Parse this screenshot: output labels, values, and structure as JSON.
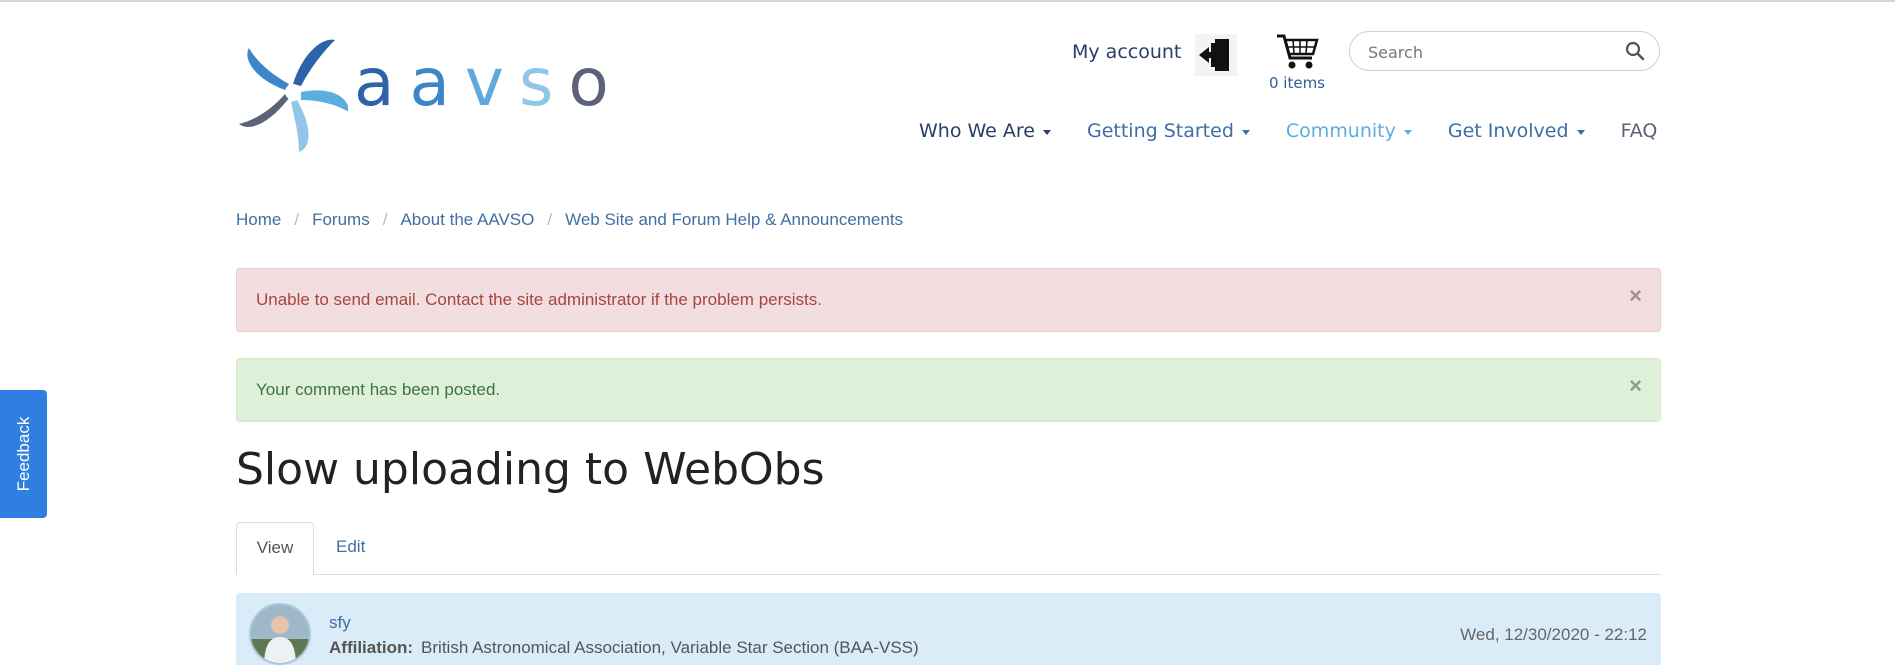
{
  "logo": {
    "letters": [
      "a",
      "a",
      "v",
      "s",
      "o"
    ]
  },
  "header": {
    "account_label": "My account",
    "cart_count": "0 items",
    "search_placeholder": "Search"
  },
  "nav": {
    "items": [
      {
        "label": "Who We Are",
        "has_dropdown": true
      },
      {
        "label": "Getting Started",
        "has_dropdown": true
      },
      {
        "label": "Community",
        "has_dropdown": true
      },
      {
        "label": "Get Involved",
        "has_dropdown": true
      },
      {
        "label": "FAQ",
        "has_dropdown": false
      }
    ]
  },
  "breadcrumb": {
    "items": [
      "Home",
      "Forums",
      "About the AAVSO",
      "Web Site and Forum Help & Announcements"
    ],
    "separator": "/"
  },
  "alerts": {
    "error": {
      "text": "Unable to send email. Contact the site administrator if the problem persists.",
      "close": "×"
    },
    "success": {
      "text": "Your comment has been posted.",
      "close": "×"
    }
  },
  "feedback": {
    "label": "Feedback"
  },
  "page": {
    "title": "Slow uploading to WebObs",
    "tabs": [
      "View",
      "Edit"
    ],
    "active_tab": "View"
  },
  "comment": {
    "author": "sfy",
    "affiliation_label": "Affiliation:",
    "affiliation": "British Astronomical Association, Variable Star Section (BAA-VSS)",
    "date": "Wed, 12/30/2020 - 22:12"
  },
  "colors": {
    "brand_dark": "#2a3d67",
    "link": "#3f6fa3",
    "community_active": "#5aaee0",
    "alert_error_bg": "#f2dede",
    "alert_success_bg": "#dff0d8",
    "feedback_bg": "#2e7fe0",
    "comment_header_bg": "#d9ecf7"
  }
}
